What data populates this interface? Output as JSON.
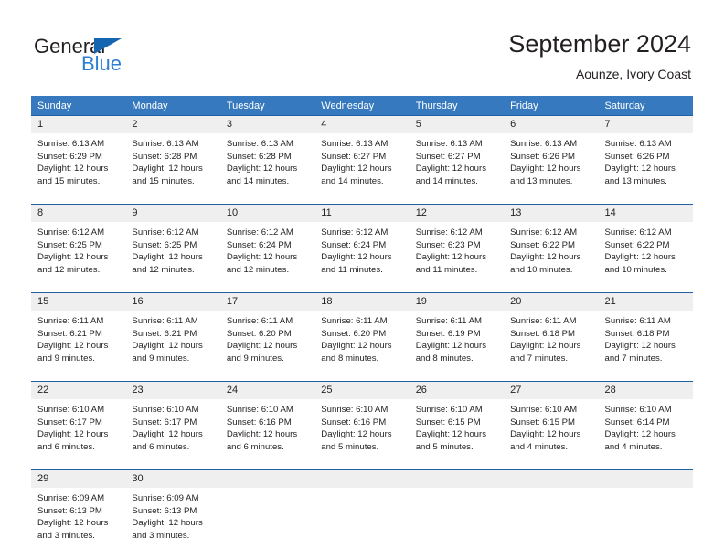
{
  "brand": {
    "name_top": "General",
    "name_bottom": "Blue",
    "accent_color": "#2b7fd1",
    "triangle_color": "#1565b0"
  },
  "header": {
    "title": "September 2024",
    "subtitle": "Aounze, Ivory Coast"
  },
  "theme": {
    "header_row_bg": "#3679be",
    "header_row_text": "#ffffff",
    "daynum_band_bg": "#efefef",
    "week_separator": "#1f5fa3"
  },
  "weekday_headers": [
    "Sunday",
    "Monday",
    "Tuesday",
    "Wednesday",
    "Thursday",
    "Friday",
    "Saturday"
  ],
  "weeks": [
    [
      {
        "day": "1",
        "sunrise": "Sunrise: 6:13 AM",
        "sunset": "Sunset: 6:29 PM",
        "daylight1": "Daylight: 12 hours",
        "daylight2": "and 15 minutes."
      },
      {
        "day": "2",
        "sunrise": "Sunrise: 6:13 AM",
        "sunset": "Sunset: 6:28 PM",
        "daylight1": "Daylight: 12 hours",
        "daylight2": "and 15 minutes."
      },
      {
        "day": "3",
        "sunrise": "Sunrise: 6:13 AM",
        "sunset": "Sunset: 6:28 PM",
        "daylight1": "Daylight: 12 hours",
        "daylight2": "and 14 minutes."
      },
      {
        "day": "4",
        "sunrise": "Sunrise: 6:13 AM",
        "sunset": "Sunset: 6:27 PM",
        "daylight1": "Daylight: 12 hours",
        "daylight2": "and 14 minutes."
      },
      {
        "day": "5",
        "sunrise": "Sunrise: 6:13 AM",
        "sunset": "Sunset: 6:27 PM",
        "daylight1": "Daylight: 12 hours",
        "daylight2": "and 14 minutes."
      },
      {
        "day": "6",
        "sunrise": "Sunrise: 6:13 AM",
        "sunset": "Sunset: 6:26 PM",
        "daylight1": "Daylight: 12 hours",
        "daylight2": "and 13 minutes."
      },
      {
        "day": "7",
        "sunrise": "Sunrise: 6:13 AM",
        "sunset": "Sunset: 6:26 PM",
        "daylight1": "Daylight: 12 hours",
        "daylight2": "and 13 minutes."
      }
    ],
    [
      {
        "day": "8",
        "sunrise": "Sunrise: 6:12 AM",
        "sunset": "Sunset: 6:25 PM",
        "daylight1": "Daylight: 12 hours",
        "daylight2": "and 12 minutes."
      },
      {
        "day": "9",
        "sunrise": "Sunrise: 6:12 AM",
        "sunset": "Sunset: 6:25 PM",
        "daylight1": "Daylight: 12 hours",
        "daylight2": "and 12 minutes."
      },
      {
        "day": "10",
        "sunrise": "Sunrise: 6:12 AM",
        "sunset": "Sunset: 6:24 PM",
        "daylight1": "Daylight: 12 hours",
        "daylight2": "and 12 minutes."
      },
      {
        "day": "11",
        "sunrise": "Sunrise: 6:12 AM",
        "sunset": "Sunset: 6:24 PM",
        "daylight1": "Daylight: 12 hours",
        "daylight2": "and 11 minutes."
      },
      {
        "day": "12",
        "sunrise": "Sunrise: 6:12 AM",
        "sunset": "Sunset: 6:23 PM",
        "daylight1": "Daylight: 12 hours",
        "daylight2": "and 11 minutes."
      },
      {
        "day": "13",
        "sunrise": "Sunrise: 6:12 AM",
        "sunset": "Sunset: 6:22 PM",
        "daylight1": "Daylight: 12 hours",
        "daylight2": "and 10 minutes."
      },
      {
        "day": "14",
        "sunrise": "Sunrise: 6:12 AM",
        "sunset": "Sunset: 6:22 PM",
        "daylight1": "Daylight: 12 hours",
        "daylight2": "and 10 minutes."
      }
    ],
    [
      {
        "day": "15",
        "sunrise": "Sunrise: 6:11 AM",
        "sunset": "Sunset: 6:21 PM",
        "daylight1": "Daylight: 12 hours",
        "daylight2": "and 9 minutes."
      },
      {
        "day": "16",
        "sunrise": "Sunrise: 6:11 AM",
        "sunset": "Sunset: 6:21 PM",
        "daylight1": "Daylight: 12 hours",
        "daylight2": "and 9 minutes."
      },
      {
        "day": "17",
        "sunrise": "Sunrise: 6:11 AM",
        "sunset": "Sunset: 6:20 PM",
        "daylight1": "Daylight: 12 hours",
        "daylight2": "and 9 minutes."
      },
      {
        "day": "18",
        "sunrise": "Sunrise: 6:11 AM",
        "sunset": "Sunset: 6:20 PM",
        "daylight1": "Daylight: 12 hours",
        "daylight2": "and 8 minutes."
      },
      {
        "day": "19",
        "sunrise": "Sunrise: 6:11 AM",
        "sunset": "Sunset: 6:19 PM",
        "daylight1": "Daylight: 12 hours",
        "daylight2": "and 8 minutes."
      },
      {
        "day": "20",
        "sunrise": "Sunrise: 6:11 AM",
        "sunset": "Sunset: 6:18 PM",
        "daylight1": "Daylight: 12 hours",
        "daylight2": "and 7 minutes."
      },
      {
        "day": "21",
        "sunrise": "Sunrise: 6:11 AM",
        "sunset": "Sunset: 6:18 PM",
        "daylight1": "Daylight: 12 hours",
        "daylight2": "and 7 minutes."
      }
    ],
    [
      {
        "day": "22",
        "sunrise": "Sunrise: 6:10 AM",
        "sunset": "Sunset: 6:17 PM",
        "daylight1": "Daylight: 12 hours",
        "daylight2": "and 6 minutes."
      },
      {
        "day": "23",
        "sunrise": "Sunrise: 6:10 AM",
        "sunset": "Sunset: 6:17 PM",
        "daylight1": "Daylight: 12 hours",
        "daylight2": "and 6 minutes."
      },
      {
        "day": "24",
        "sunrise": "Sunrise: 6:10 AM",
        "sunset": "Sunset: 6:16 PM",
        "daylight1": "Daylight: 12 hours",
        "daylight2": "and 6 minutes."
      },
      {
        "day": "25",
        "sunrise": "Sunrise: 6:10 AM",
        "sunset": "Sunset: 6:16 PM",
        "daylight1": "Daylight: 12 hours",
        "daylight2": "and 5 minutes."
      },
      {
        "day": "26",
        "sunrise": "Sunrise: 6:10 AM",
        "sunset": "Sunset: 6:15 PM",
        "daylight1": "Daylight: 12 hours",
        "daylight2": "and 5 minutes."
      },
      {
        "day": "27",
        "sunrise": "Sunrise: 6:10 AM",
        "sunset": "Sunset: 6:15 PM",
        "daylight1": "Daylight: 12 hours",
        "daylight2": "and 4 minutes."
      },
      {
        "day": "28",
        "sunrise": "Sunrise: 6:10 AM",
        "sunset": "Sunset: 6:14 PM",
        "daylight1": "Daylight: 12 hours",
        "daylight2": "and 4 minutes."
      }
    ],
    [
      {
        "day": "29",
        "sunrise": "Sunrise: 6:09 AM",
        "sunset": "Sunset: 6:13 PM",
        "daylight1": "Daylight: 12 hours",
        "daylight2": "and 3 minutes."
      },
      {
        "day": "30",
        "sunrise": "Sunrise: 6:09 AM",
        "sunset": "Sunset: 6:13 PM",
        "daylight1": "Daylight: 12 hours",
        "daylight2": "and 3 minutes."
      },
      {
        "day": "",
        "sunrise": "",
        "sunset": "",
        "daylight1": "",
        "daylight2": ""
      },
      {
        "day": "",
        "sunrise": "",
        "sunset": "",
        "daylight1": "",
        "daylight2": ""
      },
      {
        "day": "",
        "sunrise": "",
        "sunset": "",
        "daylight1": "",
        "daylight2": ""
      },
      {
        "day": "",
        "sunrise": "",
        "sunset": "",
        "daylight1": "",
        "daylight2": ""
      },
      {
        "day": "",
        "sunrise": "",
        "sunset": "",
        "daylight1": "",
        "daylight2": ""
      }
    ]
  ]
}
